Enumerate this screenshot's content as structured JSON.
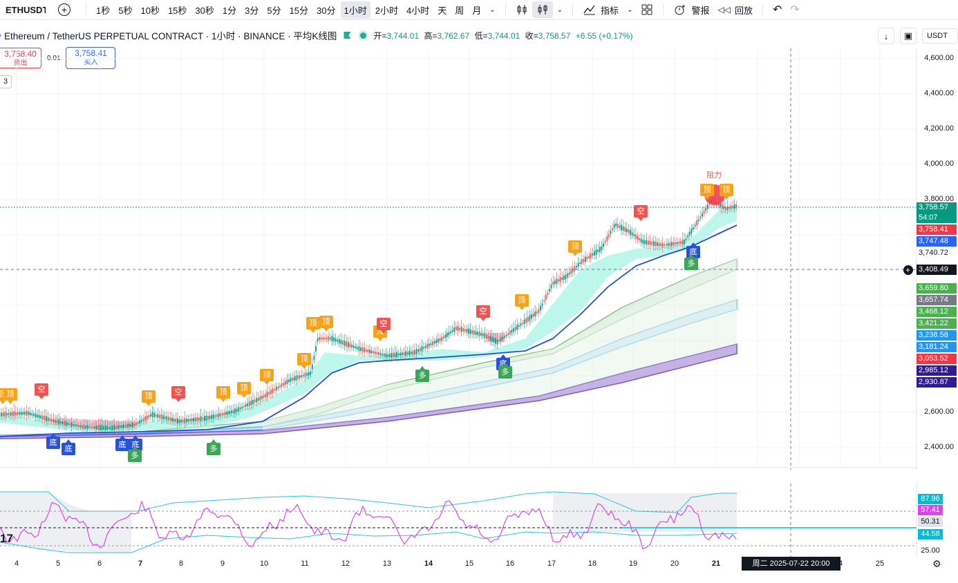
{
  "toolbar": {
    "symbol": "ETHUSDT",
    "timeframes": [
      "1秒",
      "5秒",
      "10秒",
      "15秒",
      "30秒",
      "1分",
      "3分",
      "5分",
      "15分",
      "30分",
      "1小时",
      "2小时",
      "4小时",
      "天",
      "周",
      "月"
    ],
    "active_timeframe": "1小时",
    "indicators_label": "指标",
    "alert_label": "警报",
    "replay_label": "回放"
  },
  "legend": {
    "title": "Ethereum / TetherUS PERPETUAL CONTRACT · 1小时 · BINANCE · 平均K线图",
    "open_label": "开=",
    "open": "3,744.01",
    "high_label": "高=",
    "high": "3,762.67",
    "low_label": "低=",
    "low": "3,744.01",
    "close_label": "收=",
    "close": "3,758.57",
    "change": "+6.55 (+0.17%)"
  },
  "trade": {
    "sell_price": "3,758.40",
    "sell_label": "卖出",
    "spread": "0.01",
    "buy_price": "3,758.41",
    "buy_label": "买入",
    "layer_count": "3"
  },
  "currency": "USDT",
  "price_axis": [
    "4,600.00",
    "4,400.00",
    "4,200.00",
    "4,000.00",
    "3,800.00",
    "2,600.00",
    "2,400.00"
  ],
  "price_tags": [
    {
      "value": "3,758.57",
      "sub": "54:07",
      "color": "#089981"
    },
    {
      "value": "3,758.41",
      "color": "#f23645"
    },
    {
      "value": "3,747.48",
      "color": "#2962ff"
    },
    {
      "value": "3,740.72",
      "color": "#ffffff"
    },
    {
      "value": "3,408.49",
      "color": "#131722"
    },
    {
      "value": "3,659.80",
      "color": "#4caf50"
    },
    {
      "value": "3,657.74",
      "color": "#787b86"
    },
    {
      "value": "3,468.12",
      "color": "#4caf50"
    },
    {
      "value": "3,421.22",
      "color": "#4caf50"
    },
    {
      "value": "3,238.58",
      "color": "#2196f3"
    },
    {
      "value": "3,181.24",
      "color": "#2196f3"
    },
    {
      "value": "3,053.52",
      "color": "#f23645"
    },
    {
      "value": "2,985.12",
      "color": "#311b92"
    },
    {
      "value": "2,930.87",
      "color": "#311b92"
    }
  ],
  "osc_axis": [
    "87.96",
    "57.41",
    "50.31",
    "44.58",
    "25.00"
  ],
  "x_axis": [
    "4",
    "5",
    "6",
    "7",
    "8",
    "9",
    "10",
    "11",
    "12",
    "13",
    "14",
    "15",
    "16",
    "17",
    "18",
    "19",
    "20",
    "21",
    "4",
    "25"
  ],
  "crosshair_time": "周二 2025-07-22   20:00",
  "resistance_label": "阻力",
  "marker_labels": {
    "top": "顶",
    "short": "空",
    "bottom": "底",
    "long": "多"
  },
  "osc_left_label": "17"
}
